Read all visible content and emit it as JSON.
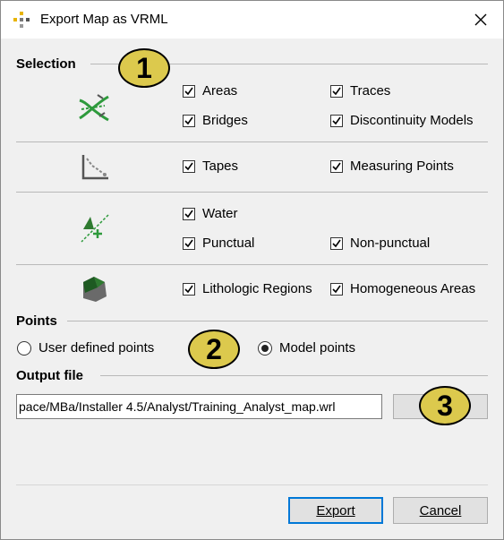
{
  "window": {
    "title": "Export Map as VRML"
  },
  "selection": {
    "label": "Selection",
    "checkboxes": {
      "areas": "Areas",
      "traces": "Traces",
      "bridges": "Bridges",
      "discontinuity_models": "Discontinuity Models",
      "tapes": "Tapes",
      "measuring_points": "Measuring Points",
      "water": "Water",
      "punctual": "Punctual",
      "non_punctual": "Non-punctual",
      "lithologic_regions": "Lithologic Regions",
      "homogeneous_areas": "Homogeneous Areas"
    },
    "checked": true
  },
  "points": {
    "label": "Points",
    "user_defined": "User defined points",
    "model_points": "Model points",
    "selected": "model_points"
  },
  "output": {
    "label": "Output file",
    "path": "pace/MBa/Installer 4.5/Analyst/Training_Analyst_map.wrl",
    "browse_label": ""
  },
  "buttons": {
    "export": "Export",
    "cancel": "Cancel"
  },
  "annotations": {
    "badge1": "1",
    "badge2": "2",
    "badge3": "3",
    "color": "#dcc94d"
  }
}
